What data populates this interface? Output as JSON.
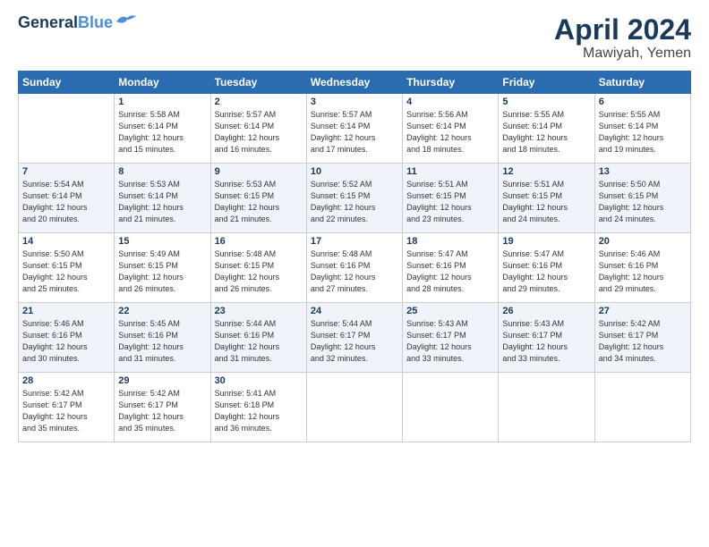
{
  "header": {
    "title": "April 2024",
    "location": "Mawiyah, Yemen"
  },
  "columns": [
    "Sunday",
    "Monday",
    "Tuesday",
    "Wednesday",
    "Thursday",
    "Friday",
    "Saturday"
  ],
  "weeks": [
    [
      {
        "day": "",
        "info": ""
      },
      {
        "day": "1",
        "info": "Sunrise: 5:58 AM\nSunset: 6:14 PM\nDaylight: 12 hours\nand 15 minutes."
      },
      {
        "day": "2",
        "info": "Sunrise: 5:57 AM\nSunset: 6:14 PM\nDaylight: 12 hours\nand 16 minutes."
      },
      {
        "day": "3",
        "info": "Sunrise: 5:57 AM\nSunset: 6:14 PM\nDaylight: 12 hours\nand 17 minutes."
      },
      {
        "day": "4",
        "info": "Sunrise: 5:56 AM\nSunset: 6:14 PM\nDaylight: 12 hours\nand 18 minutes."
      },
      {
        "day": "5",
        "info": "Sunrise: 5:55 AM\nSunset: 6:14 PM\nDaylight: 12 hours\nand 18 minutes."
      },
      {
        "day": "6",
        "info": "Sunrise: 5:55 AM\nSunset: 6:14 PM\nDaylight: 12 hours\nand 19 minutes."
      }
    ],
    [
      {
        "day": "7",
        "info": "Sunrise: 5:54 AM\nSunset: 6:14 PM\nDaylight: 12 hours\nand 20 minutes."
      },
      {
        "day": "8",
        "info": "Sunrise: 5:53 AM\nSunset: 6:14 PM\nDaylight: 12 hours\nand 21 minutes."
      },
      {
        "day": "9",
        "info": "Sunrise: 5:53 AM\nSunset: 6:15 PM\nDaylight: 12 hours\nand 21 minutes."
      },
      {
        "day": "10",
        "info": "Sunrise: 5:52 AM\nSunset: 6:15 PM\nDaylight: 12 hours\nand 22 minutes."
      },
      {
        "day": "11",
        "info": "Sunrise: 5:51 AM\nSunset: 6:15 PM\nDaylight: 12 hours\nand 23 minutes."
      },
      {
        "day": "12",
        "info": "Sunrise: 5:51 AM\nSunset: 6:15 PM\nDaylight: 12 hours\nand 24 minutes."
      },
      {
        "day": "13",
        "info": "Sunrise: 5:50 AM\nSunset: 6:15 PM\nDaylight: 12 hours\nand 24 minutes."
      }
    ],
    [
      {
        "day": "14",
        "info": "Sunrise: 5:50 AM\nSunset: 6:15 PM\nDaylight: 12 hours\nand 25 minutes."
      },
      {
        "day": "15",
        "info": "Sunrise: 5:49 AM\nSunset: 6:15 PM\nDaylight: 12 hours\nand 26 minutes."
      },
      {
        "day": "16",
        "info": "Sunrise: 5:48 AM\nSunset: 6:15 PM\nDaylight: 12 hours\nand 26 minutes."
      },
      {
        "day": "17",
        "info": "Sunrise: 5:48 AM\nSunset: 6:16 PM\nDaylight: 12 hours\nand 27 minutes."
      },
      {
        "day": "18",
        "info": "Sunrise: 5:47 AM\nSunset: 6:16 PM\nDaylight: 12 hours\nand 28 minutes."
      },
      {
        "day": "19",
        "info": "Sunrise: 5:47 AM\nSunset: 6:16 PM\nDaylight: 12 hours\nand 29 minutes."
      },
      {
        "day": "20",
        "info": "Sunrise: 5:46 AM\nSunset: 6:16 PM\nDaylight: 12 hours\nand 29 minutes."
      }
    ],
    [
      {
        "day": "21",
        "info": "Sunrise: 5:46 AM\nSunset: 6:16 PM\nDaylight: 12 hours\nand 30 minutes."
      },
      {
        "day": "22",
        "info": "Sunrise: 5:45 AM\nSunset: 6:16 PM\nDaylight: 12 hours\nand 31 minutes."
      },
      {
        "day": "23",
        "info": "Sunrise: 5:44 AM\nSunset: 6:16 PM\nDaylight: 12 hours\nand 31 minutes."
      },
      {
        "day": "24",
        "info": "Sunrise: 5:44 AM\nSunset: 6:17 PM\nDaylight: 12 hours\nand 32 minutes."
      },
      {
        "day": "25",
        "info": "Sunrise: 5:43 AM\nSunset: 6:17 PM\nDaylight: 12 hours\nand 33 minutes."
      },
      {
        "day": "26",
        "info": "Sunrise: 5:43 AM\nSunset: 6:17 PM\nDaylight: 12 hours\nand 33 minutes."
      },
      {
        "day": "27",
        "info": "Sunrise: 5:42 AM\nSunset: 6:17 PM\nDaylight: 12 hours\nand 34 minutes."
      }
    ],
    [
      {
        "day": "28",
        "info": "Sunrise: 5:42 AM\nSunset: 6:17 PM\nDaylight: 12 hours\nand 35 minutes."
      },
      {
        "day": "29",
        "info": "Sunrise: 5:42 AM\nSunset: 6:17 PM\nDaylight: 12 hours\nand 35 minutes."
      },
      {
        "day": "30",
        "info": "Sunrise: 5:41 AM\nSunset: 6:18 PM\nDaylight: 12 hours\nand 36 minutes."
      },
      {
        "day": "",
        "info": ""
      },
      {
        "day": "",
        "info": ""
      },
      {
        "day": "",
        "info": ""
      },
      {
        "day": "",
        "info": ""
      }
    ]
  ]
}
